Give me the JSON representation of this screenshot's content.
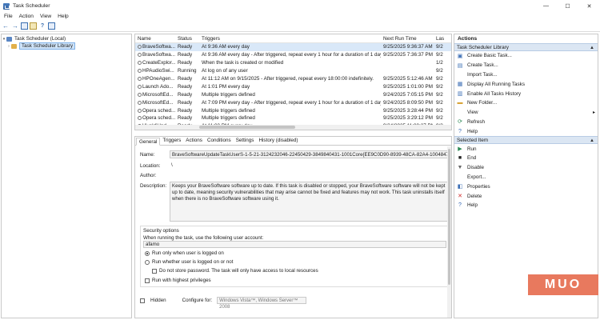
{
  "window": {
    "title": "Task Scheduler",
    "controls": [
      "—",
      "☐",
      "✕"
    ]
  },
  "menu": [
    "File",
    "Action",
    "View",
    "Help"
  ],
  "tree": {
    "root": "Task Scheduler (Local)",
    "child": "Task Scheduler Library"
  },
  "task_list": {
    "columns": [
      "Name",
      "Status",
      "Triggers",
      "Next Run Time",
      "Las"
    ],
    "rows": [
      {
        "name": "BraveSoftwa...",
        "status": "Ready",
        "trigger": "At 9:36 AM every day",
        "next": "9/25/2025 9:36:37 AM",
        "last": "9/2"
      },
      {
        "name": "BraveSoftwa...",
        "status": "Ready",
        "trigger": "At 9:36 AM every day - After triggered, repeat every 1 hour for a duration of 1 day.",
        "next": "9/25/2025 7:36:37 PM",
        "last": "9/2"
      },
      {
        "name": "CreateExplor...",
        "status": "Ready",
        "trigger": "When the task is created or modified",
        "next": "",
        "last": "1/2"
      },
      {
        "name": "HPAudioSwi...",
        "status": "Running",
        "trigger": "At log on of any user",
        "next": "",
        "last": "9/2"
      },
      {
        "name": "HPOneAgen...",
        "status": "Ready",
        "trigger": "At 11:12 AM on 9/15/2025 - After triggered, repeat every 18:00:00 indefinitely.",
        "next": "9/25/2025 5:12:46 AM",
        "last": "9/2"
      },
      {
        "name": "Launch Ado...",
        "status": "Ready",
        "trigger": "At 1:01 PM every day",
        "next": "9/25/2025 1:01:00 PM",
        "last": "9/2"
      },
      {
        "name": "MicrosoftEd...",
        "status": "Ready",
        "trigger": "Multiple triggers defined",
        "next": "9/24/2025 7:05:15 PM",
        "last": "9/2"
      },
      {
        "name": "MicrosoftEd...",
        "status": "Ready",
        "trigger": "At 7:09 PM every day - After triggered, repeat every 1 hour for a duration of 1 day.",
        "next": "9/24/2025 8:09:50 PM",
        "last": "9/2"
      },
      {
        "name": "Opera sched...",
        "status": "Ready",
        "trigger": "Multiple triggers defined",
        "next": "9/25/2025 3:28:44 PM",
        "last": "9/2"
      },
      {
        "name": "Opera sched...",
        "status": "Ready",
        "trigger": "Multiple triggers defined",
        "next": "9/25/2025 3:29:12 PM",
        "last": "9/2"
      },
      {
        "name": "VivaldiUpd...",
        "status": "Ready",
        "trigger": "At 11:00 PM every day",
        "next": "9/24/2025 11:00:37 PM",
        "last": "9/2"
      }
    ]
  },
  "details": {
    "tabs": [
      "General",
      "Triggers",
      "Actions",
      "Conditions",
      "Settings",
      "History (disabled)"
    ],
    "name_label": "Name:",
    "name_value": "BraveSoftwareUpdateTaskUserS-1-5-21-3124232046-22450429-3849840431-1001Core{EE9C0D90-8939-48CA-82A4-10048472C5C6}",
    "location_label": "Location:",
    "location_value": "\\",
    "author_label": "Author:",
    "author_value": "",
    "description_label": "Description:",
    "description_value": "Keeps your BraveSoftware software up to date. If this task is disabled or stopped, your BraveSoftware software will not be kept up to date, meaning security vulnerabilities that may arise cannot be fixed and features may not work. This task uninstalls itself when there is no BraveSoftware software using it.",
    "security": {
      "title": "Security options",
      "account_prompt": "When running the task, use the following user account:",
      "account": "afamo",
      "opt_logged_on": "Run only when user is logged on",
      "opt_whether": "Run whether user is logged on or not",
      "opt_no_password": "Do not store password.  The task will only have access to local resources",
      "opt_highest": "Run with highest privileges"
    },
    "hidden_label": "Hidden",
    "configure_label": "Configure for:",
    "configure_value": "Windows Vista™, Windows Server™ 2008"
  },
  "actions": {
    "header": "Actions",
    "section1": "Task Scheduler Library",
    "items1": [
      "Create Basic Task...",
      "Create Task...",
      "Import Task...",
      "Display All Running Tasks",
      "Enable All Tasks History",
      "New Folder...",
      "View",
      "Refresh",
      "Help"
    ],
    "section2": "Selected Item",
    "items2": [
      "Run",
      "End",
      "Disable",
      "Export...",
      "Properties",
      "Delete",
      "Help"
    ]
  },
  "watermark": "MUO"
}
